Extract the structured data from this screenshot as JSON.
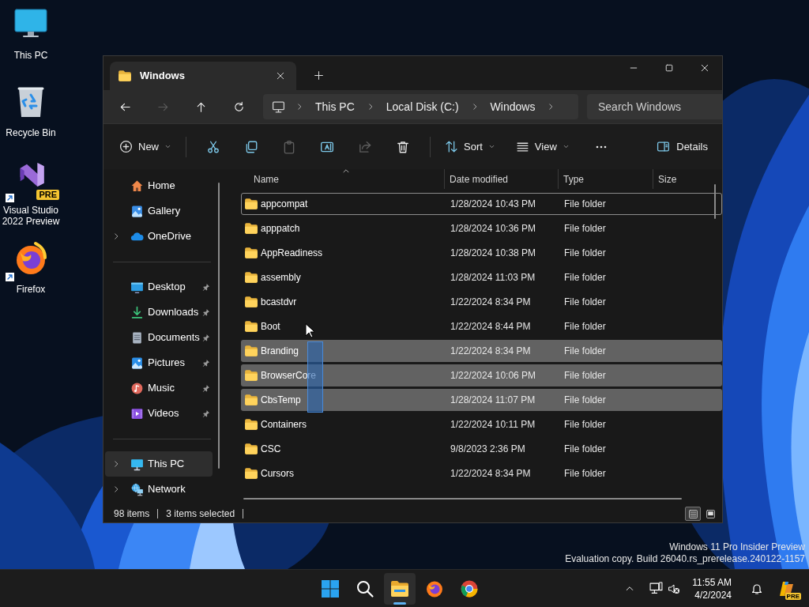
{
  "desktop_icons": [
    {
      "kind": "pc",
      "label": "This PC",
      "shortcut": false
    },
    {
      "kind": "recycle",
      "label": "Recycle Bin",
      "shortcut": false
    },
    {
      "kind": "vs",
      "label": "Visual Studio 2022 Preview",
      "badge": "PRE",
      "shortcut": true
    },
    {
      "kind": "firefox",
      "label": "Firefox",
      "shortcut": true
    }
  ],
  "window": {
    "tabs": [
      {
        "title": "Windows",
        "selected": true
      }
    ],
    "nav": [
      {
        "kind": "back",
        "disabled": false
      },
      {
        "kind": "forward",
        "disabled": true
      },
      {
        "kind": "up",
        "disabled": false
      },
      {
        "kind": "refresh",
        "disabled": false
      }
    ],
    "breadcrumb": [
      "This PC",
      "Local Disk (C:)",
      "Windows"
    ],
    "search": {
      "placeholder": "Search Windows"
    },
    "toolbar": [
      {
        "kind": "new",
        "label": "New"
      },
      {
        "kind": "separator"
      },
      {
        "kind": "cut",
        "disabled": false
      },
      {
        "kind": "copy",
        "disabled": false
      },
      {
        "kind": "paste",
        "disabled": true
      },
      {
        "kind": "rename",
        "disabled": false
      },
      {
        "kind": "share",
        "disabled": true
      },
      {
        "kind": "delete",
        "disabled": false
      },
      {
        "kind": "separator"
      },
      {
        "kind": "sort",
        "label": "Sort"
      },
      {
        "kind": "view",
        "label": "View"
      },
      {
        "kind": "more"
      }
    ],
    "details_button": {
      "label": "Details"
    },
    "sidebar": [
      [
        {
          "kind": "home",
          "label": "Home",
          "expandable": false,
          "pinned": false,
          "selected": false
        },
        {
          "kind": "gallery",
          "label": "Gallery",
          "expandable": false,
          "pinned": false,
          "selected": false
        },
        {
          "kind": "onedrive",
          "label": "OneDrive",
          "expandable": true,
          "pinned": false,
          "selected": false
        }
      ],
      [
        {
          "kind": "desktop",
          "label": "Desktop",
          "expandable": false,
          "pinned": true,
          "selected": false
        },
        {
          "kind": "downloads",
          "label": "Downloads",
          "expandable": false,
          "pinned": true,
          "selected": false
        },
        {
          "kind": "documents",
          "label": "Documents",
          "expandable": false,
          "pinned": true,
          "selected": false
        },
        {
          "kind": "pictures",
          "label": "Pictures",
          "expandable": false,
          "pinned": true,
          "selected": false
        },
        {
          "kind": "music",
          "label": "Music",
          "expandable": false,
          "pinned": true,
          "selected": false
        },
        {
          "kind": "videos",
          "label": "Videos",
          "expandable": false,
          "pinned": true,
          "selected": false
        }
      ],
      [
        {
          "kind": "pc",
          "label": "This PC",
          "expandable": true,
          "pinned": false,
          "selected": true
        },
        {
          "kind": "network",
          "label": "Network",
          "expandable": true,
          "pinned": false,
          "selected": false
        }
      ]
    ],
    "columns": [
      {
        "label": "Name",
        "sorted": true
      },
      {
        "label": "Date modified",
        "sorted": false
      },
      {
        "label": "Type",
        "sorted": false
      },
      {
        "label": "Size",
        "sorted": false
      }
    ],
    "rows": [
      {
        "name": "appcompat",
        "date": "1/28/2024 10:43 PM",
        "type": "File folder",
        "selected": false,
        "focused": true
      },
      {
        "name": "apppatch",
        "date": "1/28/2024 10:36 PM",
        "type": "File folder",
        "selected": false,
        "focused": false
      },
      {
        "name": "AppReadiness",
        "date": "1/28/2024 10:38 PM",
        "type": "File folder",
        "selected": false,
        "focused": false
      },
      {
        "name": "assembly",
        "date": "1/28/2024 11:03 PM",
        "type": "File folder",
        "selected": false,
        "focused": false
      },
      {
        "name": "bcastdvr",
        "date": "1/22/2024 8:34 PM",
        "type": "File folder",
        "selected": false,
        "focused": false
      },
      {
        "name": "Boot",
        "date": "1/22/2024 8:44 PM",
        "type": "File folder",
        "selected": false,
        "focused": false
      },
      {
        "name": "Branding",
        "date": "1/22/2024 8:34 PM",
        "type": "File folder",
        "selected": true,
        "focused": false
      },
      {
        "name": "BrowserCore",
        "date": "1/22/2024 10:06 PM",
        "type": "File folder",
        "selected": true,
        "focused": false
      },
      {
        "name": "CbsTemp",
        "date": "1/28/2024 11:07 PM",
        "type": "File folder",
        "selected": true,
        "focused": false
      },
      {
        "name": "Containers",
        "date": "1/22/2024 10:11 PM",
        "type": "File folder",
        "selected": false,
        "focused": false
      },
      {
        "name": "CSC",
        "date": "9/8/2023 2:36 PM",
        "type": "File folder",
        "selected": false,
        "focused": false
      },
      {
        "name": "Cursors",
        "date": "1/22/2024 8:34 PM",
        "type": "File folder",
        "selected": false,
        "focused": false
      }
    ],
    "status_bar": {
      "item_count": "98 items",
      "selection": "3 items selected"
    },
    "view_modes": [
      {
        "kind": "details",
        "selected": true
      },
      {
        "kind": "tiles",
        "selected": false
      }
    ]
  },
  "taskbar": {
    "apps": [
      {
        "kind": "start",
        "active": false
      },
      {
        "kind": "search",
        "active": false
      },
      {
        "kind": "explorer",
        "active": true
      },
      {
        "kind": "firefox",
        "active": false
      },
      {
        "kind": "chrome",
        "active": false
      }
    ],
    "clock": {
      "time": "11:55 AM",
      "date": "4/2/2024"
    },
    "copilot_badge": "PRE"
  },
  "evaluation_notice": [
    "Windows 11 Pro Insider Preview",
    "Evaluation copy. Build 26040.rs_prerelease.240122-1157"
  ]
}
